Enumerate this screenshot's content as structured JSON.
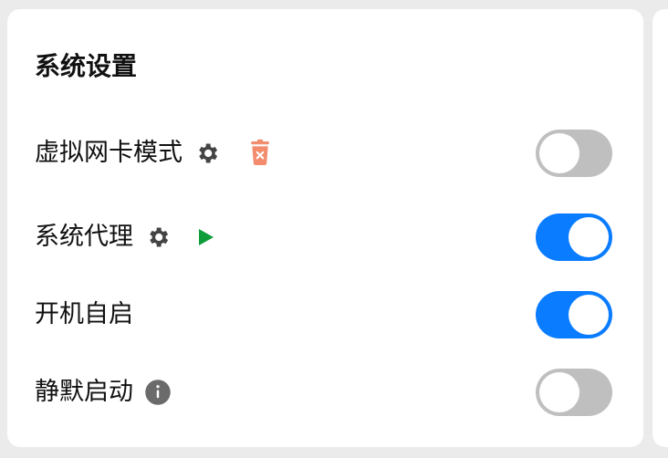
{
  "panel": {
    "title": "系统设置"
  },
  "rows": [
    {
      "label": "虚拟网卡模式",
      "enabled": false,
      "icons": [
        "gear-icon",
        "trash-icon"
      ]
    },
    {
      "label": "系统代理",
      "enabled": true,
      "icons": [
        "gear-icon",
        "play-icon"
      ]
    },
    {
      "label": "开机自启",
      "enabled": true,
      "icons": []
    },
    {
      "label": "静默启动",
      "enabled": false,
      "icons": [
        "info-icon"
      ]
    }
  ],
  "colors": {
    "toggle_on": "#0a7cff",
    "toggle_off": "#bfbfbf",
    "gear": "#444444",
    "trash": "#f38b6d",
    "play": "#0f9d3a",
    "info": "#6b6b6b"
  }
}
